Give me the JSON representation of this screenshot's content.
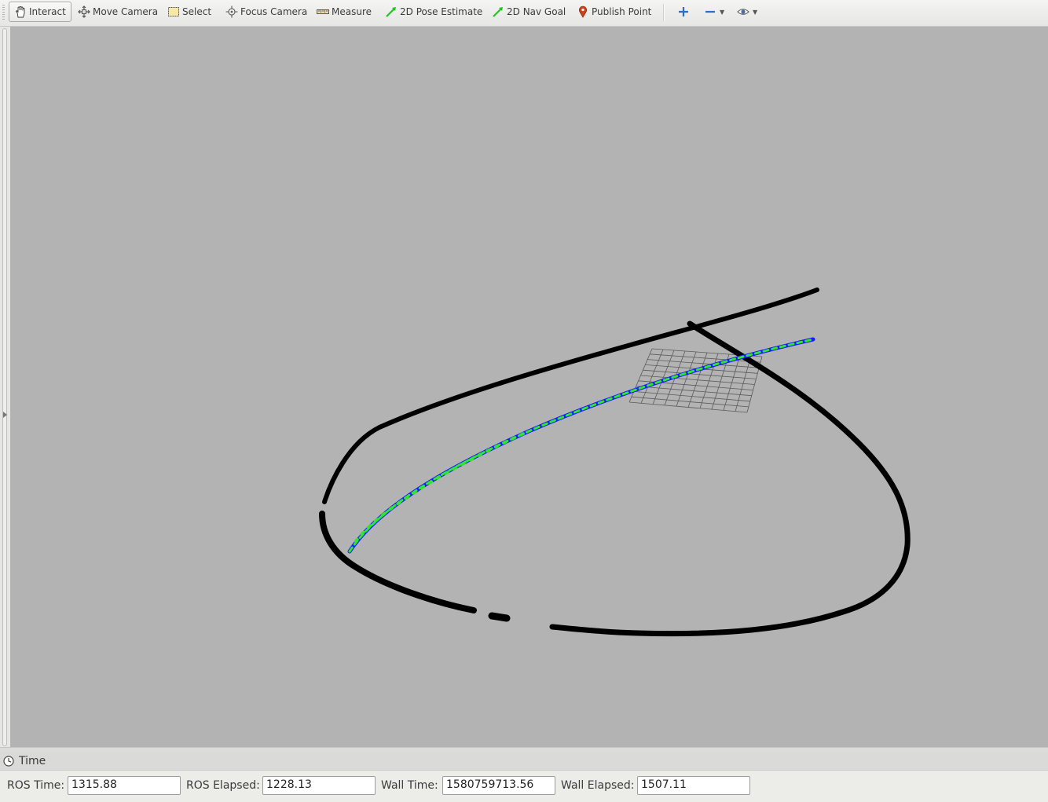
{
  "toolbar": {
    "tools": [
      {
        "label": "Interact",
        "icon": "hand-icon",
        "active": true
      },
      {
        "label": "Move Camera",
        "icon": "move-camera-icon"
      },
      {
        "label": "Select",
        "icon": "select-icon"
      },
      {
        "label": "Focus Camera",
        "icon": "focus-camera-icon"
      },
      {
        "label": "Measure",
        "icon": "ruler-icon"
      },
      {
        "label": "2D Pose Estimate",
        "icon": "pose-arrow-icon"
      },
      {
        "label": "2D Nav Goal",
        "icon": "nav-arrow-icon"
      },
      {
        "label": "Publish Point",
        "icon": "map-pin-icon"
      }
    ],
    "extra_icons": [
      "add-tool-icon",
      "remove-tool-icon",
      "view-eye-icon"
    ]
  },
  "viewport": {
    "background": "#b3b3b3",
    "track_color": "#000000",
    "path_colors": [
      "#1a1aff",
      "#2ee62e"
    ],
    "grid_color": "#555555"
  },
  "time_panel": {
    "title": "Time",
    "ros_time_label": "ROS Time:",
    "ros_time": "1315.88",
    "ros_elapsed_label": "ROS Elapsed:",
    "ros_elapsed": "1228.13",
    "wall_time_label": "Wall Time:",
    "wall_time": "1580759713.56",
    "wall_elapsed_label": "Wall Elapsed:",
    "wall_elapsed": "1507.11"
  }
}
